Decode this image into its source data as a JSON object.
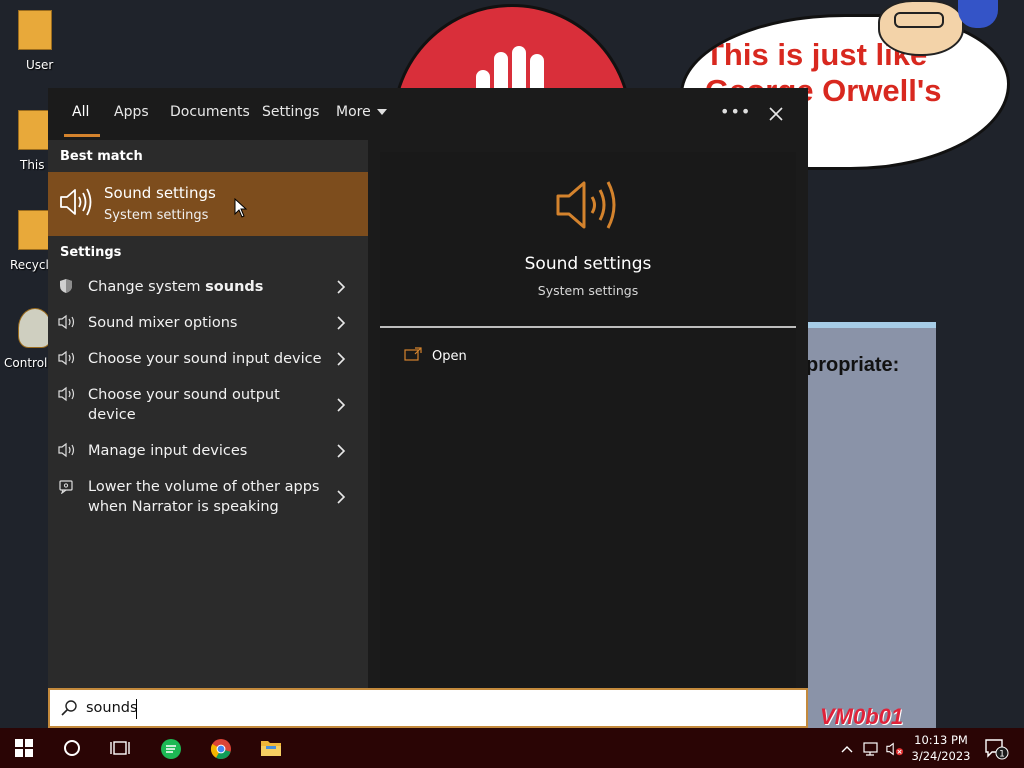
{
  "desktop": {
    "icons": [
      {
        "label": "User"
      },
      {
        "label": "This P"
      },
      {
        "label": "Recycle"
      },
      {
        "label": "Control P"
      }
    ],
    "speech_bubble_text": "This is just like George Orwell's",
    "partial_window_text": "propriate:",
    "watermark": "VM0b01"
  },
  "search": {
    "tabs": [
      {
        "label": "All",
        "active": true
      },
      {
        "label": "Apps"
      },
      {
        "label": "Documents"
      },
      {
        "label": "Settings"
      },
      {
        "label": "More"
      }
    ],
    "best_match_heading": "Best match",
    "best_match": {
      "title": "Sound settings",
      "subtitle": "System settings",
      "icon": "speaker-icon"
    },
    "settings_heading": "Settings",
    "settings_items": [
      {
        "label_prefix": "Change system ",
        "label_bold": "sounds",
        "icon": "shield-icon"
      },
      {
        "label_prefix": "Sound mixer options",
        "label_bold": "",
        "icon": "speaker-icon"
      },
      {
        "label_prefix": "Choose your sound input device",
        "label_bold": "",
        "icon": "speaker-icon"
      },
      {
        "label_prefix": "Choose your sound output device",
        "label_bold": "",
        "icon": "speaker-icon"
      },
      {
        "label_prefix": "Manage input devices",
        "label_bold": "",
        "icon": "speaker-icon"
      },
      {
        "label_prefix": "Lower the volume of other apps when Narrator is speaking",
        "label_bold": "",
        "icon": "narrator-icon"
      }
    ],
    "preview": {
      "title": "Sound settings",
      "subtitle": "System settings",
      "action_label": "Open"
    },
    "query": "sounds",
    "accent_color": "#d4832d",
    "highlight_color": "#7d4d1d"
  },
  "taskbar": {
    "clock_time": "10:13 PM",
    "clock_date": "3/24/2023",
    "notification_count": "1"
  }
}
